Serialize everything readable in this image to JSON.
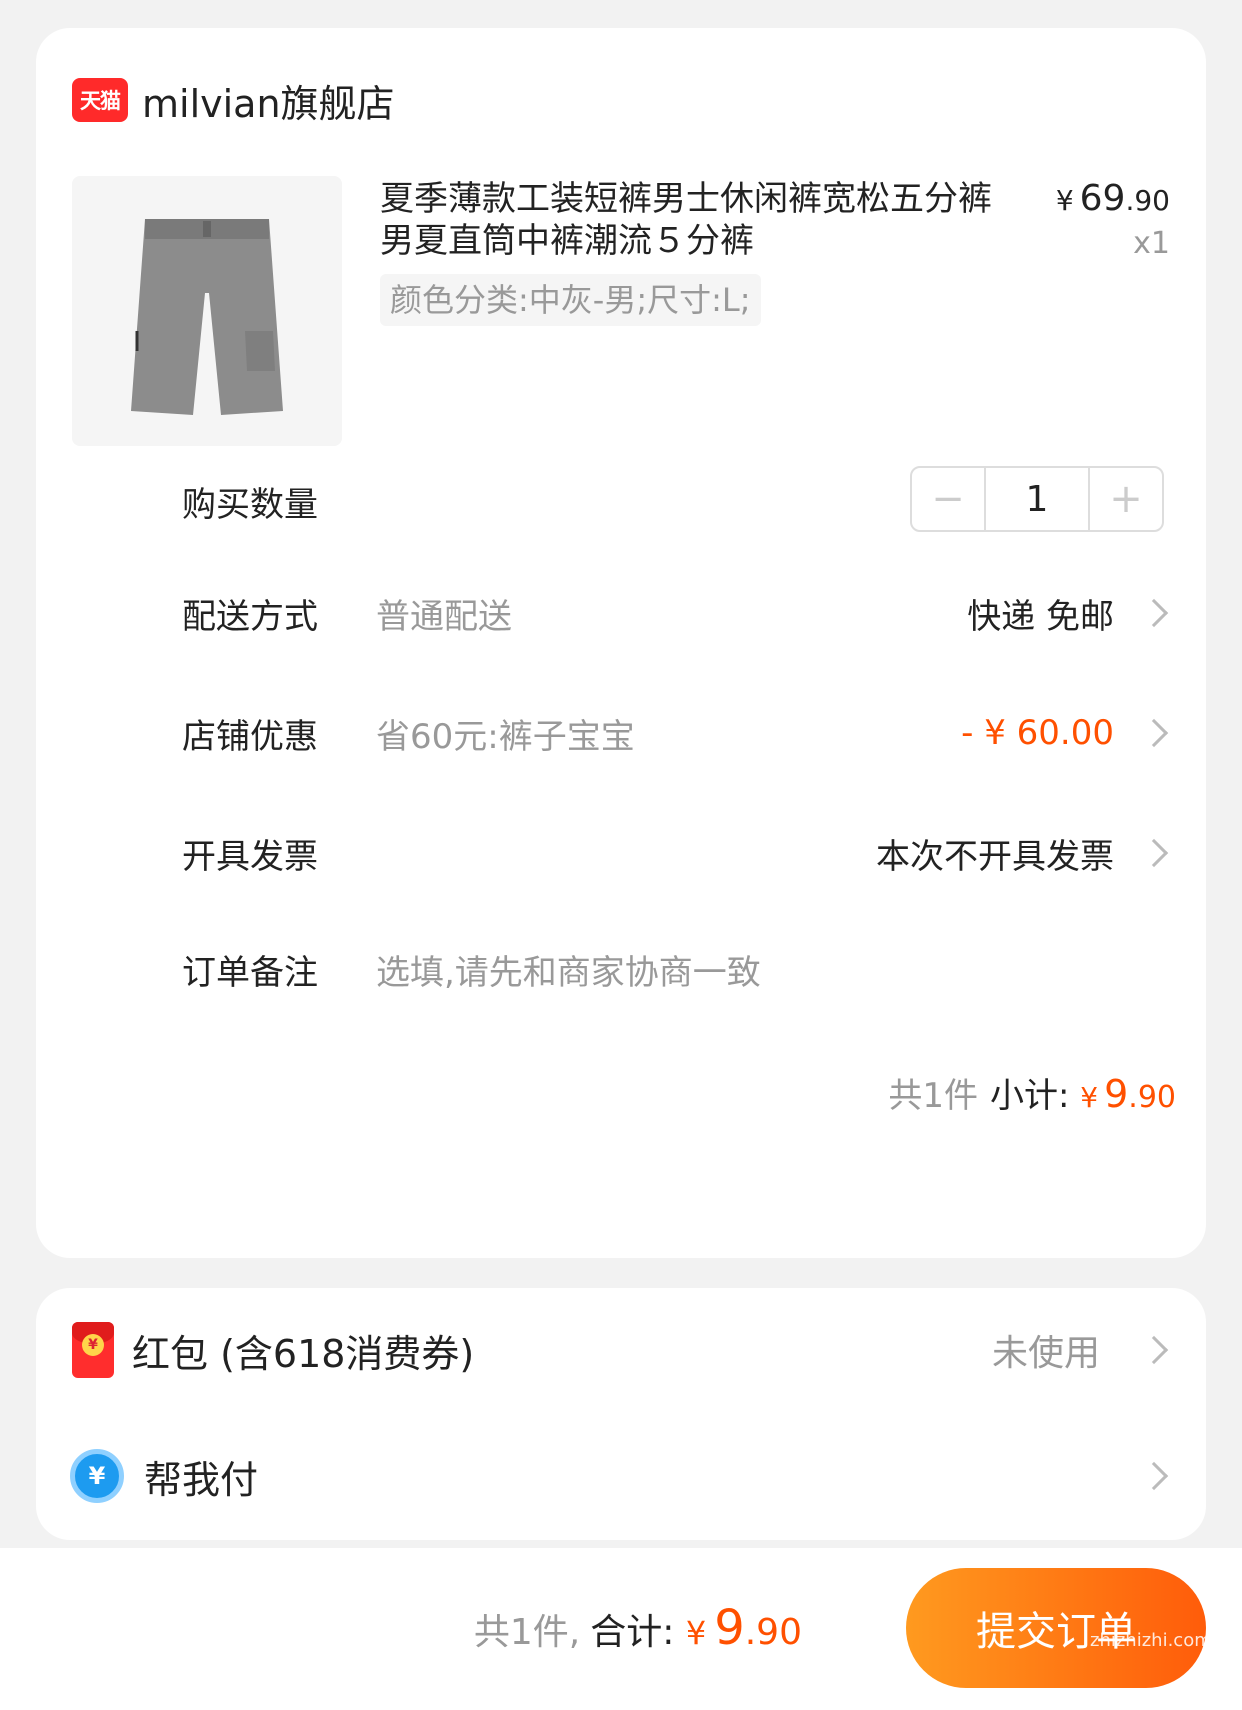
{
  "shop": {
    "logo_text": "天猫",
    "name": "milvian旗舰店"
  },
  "product": {
    "image_icon": "gray-shorts-image",
    "title": "夏季薄款工装短裤男士休闲裤宽松五分裤男夏直筒中裤潮流５分裤",
    "price_currency": "¥",
    "price_int": "69",
    "price_dec": ".90",
    "quantity_label": "x1",
    "sku": "颜色分类:中灰-男;尺寸:L;"
  },
  "rows": {
    "quantity": {
      "label": "购买数量",
      "minus": "−",
      "value": "1",
      "plus": "+"
    },
    "delivery": {
      "label": "配送方式",
      "desc": "普通配送",
      "value": "快递 免邮"
    },
    "discount": {
      "label": "店铺优惠",
      "desc": "省60元:裤子宝宝",
      "value": "- ¥ 60.00"
    },
    "invoice": {
      "label": "开具发票",
      "value": "本次不开具发票"
    },
    "note": {
      "label": "订单备注",
      "placeholder": "选填,请先和商家协商一致"
    }
  },
  "subtotal": {
    "count": "共1件",
    "label": "小计:",
    "currency": "¥",
    "int": "9",
    "dec": ".90"
  },
  "extras": {
    "hongbao": {
      "icon": "red-envelope-icon",
      "coin": "¥",
      "label": "红包 (含618消费券)",
      "value": "未使用"
    },
    "helppay": {
      "icon": "yuan-circle-icon",
      "symbol": "¥",
      "label": "帮我付"
    }
  },
  "bottom": {
    "count": "共1件,",
    "label": "合计:",
    "currency": "¥",
    "int": "9",
    "dec": ".90",
    "submit": "提交订单"
  },
  "watermark": "zhizhizhi.com",
  "colors": {
    "accent": "#ff5000",
    "tmall_red": "#ff2a2a",
    "button_gradient_start": "#ff9a1f",
    "button_gradient_end": "#ff5c0a"
  }
}
